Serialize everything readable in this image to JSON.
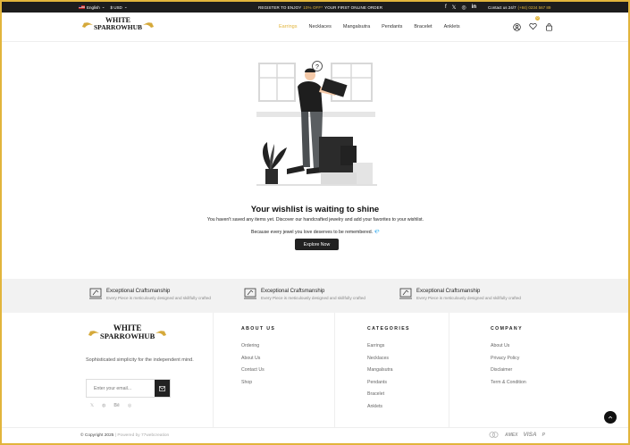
{
  "topbar": {
    "language": "English",
    "currency": "$ USD",
    "promo_prefix": "REGISTER TO ENJOY",
    "promo_highlight": "10% OFF*",
    "promo_suffix": "YOUR FIRST ONLINE ORDER",
    "contact_label": "Contact us 24/7",
    "contact_phone": "(+84) 0234 567 89"
  },
  "brand": {
    "line1": "WHITE",
    "line2": "SPARROWHUB"
  },
  "nav": {
    "items": [
      "Earrings",
      "Necklaces",
      "Mangalsutra",
      "Pendants",
      "Bracelet",
      "Anklets"
    ],
    "active": 0,
    "wishlist_count": "0"
  },
  "main": {
    "title": "Your wishlist is waiting to shine",
    "line1": "You haven't saved any items yet. Discover our handcrafted jewelry and add your favorites to your wishlist.",
    "line2": "Because every jewel you love deserves to be remembered.",
    "line2_emoji": "💎",
    "button": "Explore Now"
  },
  "features": [
    {
      "title": "Exceptional Craftsmanship",
      "subtitle": "Every Piece is meticulously designed and skillfully crafted"
    },
    {
      "title": "Exceptional Craftsmanship",
      "subtitle": "Every Piece is meticulously designed and skillfully crafted"
    },
    {
      "title": "Exceptional Craftsmanship",
      "subtitle": "Every Piece is meticulously designed and skillfully crafted"
    }
  ],
  "footer": {
    "tagline": "Sophisticated simplicity for the independent mind.",
    "email_placeholder": "Enter your email...",
    "about": {
      "heading": "ABOUT US",
      "links": [
        "Ordering",
        "About Us",
        "Contact Us",
        "Shop"
      ]
    },
    "categories": {
      "heading": "CATEGORIES",
      "links": [
        "Earrings",
        "Necklaces",
        "Mangalsutra",
        "Pendants",
        "Bracelet",
        "Anklets"
      ]
    },
    "company": {
      "heading": "COMPANY",
      "links": [
        "About Us",
        "Privacy Policy",
        "Disclaimer",
        "Term & Condition"
      ]
    },
    "copyright": "© Copyright 2025",
    "powered": "| Powered by 77webcreation",
    "payments": [
      "AMEX",
      "VISA"
    ]
  },
  "colors": {
    "accent": "#e2b53c",
    "dark": "#1d1d1d"
  }
}
